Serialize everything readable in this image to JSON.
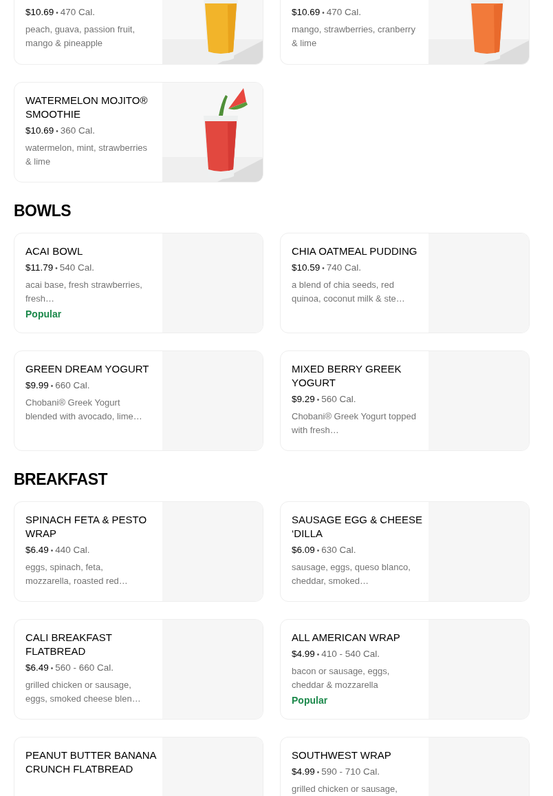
{
  "sections": [
    {
      "items": [
        {
          "price": "$10.69",
          "sep": "•",
          "calories": "470 Cal.",
          "description": "peach, guava, passion fruit, mango & pineapple"
        },
        {
          "price": "$10.69",
          "sep": "•",
          "calories": "470 Cal.",
          "description": "mango, strawberries, cranberry & lime"
        },
        {
          "name": "WATERMELON MOJITO® SMOOTHIE",
          "price": "$10.69",
          "sep": "•",
          "calories": "360 Cal.",
          "description": "watermelon, mint, strawberries & lime"
        }
      ]
    },
    {
      "title": "BOWLS",
      "items": [
        {
          "name": "ACAI BOWL",
          "price": "$11.79",
          "sep": "•",
          "calories": "540 Cal.",
          "description": "acai base, fresh strawberries, fresh…",
          "badge": "Popular",
          "image": {
            "kind": "placeholder"
          }
        },
        {
          "name": "CHIA OATMEAL PUDDING",
          "price": "$10.59",
          "sep": "•",
          "calories": "740 Cal.",
          "description": "a blend of chia seeds, red quinoa, coconut milk & ste…",
          "image": {
            "kind": "placeholder"
          }
        },
        {
          "name": "GREEN DREAM YOGURT",
          "price": "$9.99",
          "sep": "•",
          "calories": "660 Cal.",
          "description": "Chobani® Greek Yogurt blended with avocado, lime…",
          "image": {
            "kind": "placeholder"
          }
        },
        {
          "name": "MIXED BERRY GREEK YOGURT",
          "price": "$9.29",
          "sep": "•",
          "calories": "560 Cal.",
          "description": "Chobani® Greek Yogurt topped with fresh…",
          "image": {
            "kind": "placeholder"
          }
        }
      ]
    },
    {
      "title": "BREAKFAST",
      "items": [
        {
          "name": "SPINACH FETA & PESTO WRAP",
          "price": "$6.49",
          "sep": "•",
          "calories": "440 Cal.",
          "description": "eggs, spinach, feta, mozzarella, roasted red…",
          "image": {
            "kind": "placeholder"
          }
        },
        {
          "name": "SAUSAGE EGG & CHEESE ‘DILLA",
          "price": "$6.09",
          "sep": "•",
          "calories": "630 Cal.",
          "description": "sausage, eggs, queso blanco, cheddar, smoked…",
          "image": {
            "kind": "placeholder"
          }
        },
        {
          "name": "CALI BREAKFAST FLATBREAD",
          "price": "$6.49",
          "sep": "•",
          "calories": "560 - 660 Cal.",
          "description": "grilled chicken or sausage, eggs, smoked cheese blen…",
          "image": {
            "kind": "placeholder"
          }
        },
        {
          "name": "ALL AMERICAN WRAP",
          "price": "$4.99",
          "sep": "•",
          "calories": "410 - 540 Cal.",
          "description": "bacon or sausage, eggs, cheddar & mozzarella",
          "badge": "Popular",
          "image": {
            "kind": "placeholder"
          }
        },
        {
          "name": "PEANUT BUTTER BANANA CRUNCH FLATBREAD",
          "image": {
            "kind": "placeholder"
          }
        },
        {
          "name": "SOUTHWEST WRAP",
          "price": "$4.99",
          "sep": "•",
          "calories": "590 - 710 Cal.",
          "description": "grilled chicken or sausage,",
          "image": {
            "kind": "placeholder"
          }
        }
      ]
    }
  ]
}
